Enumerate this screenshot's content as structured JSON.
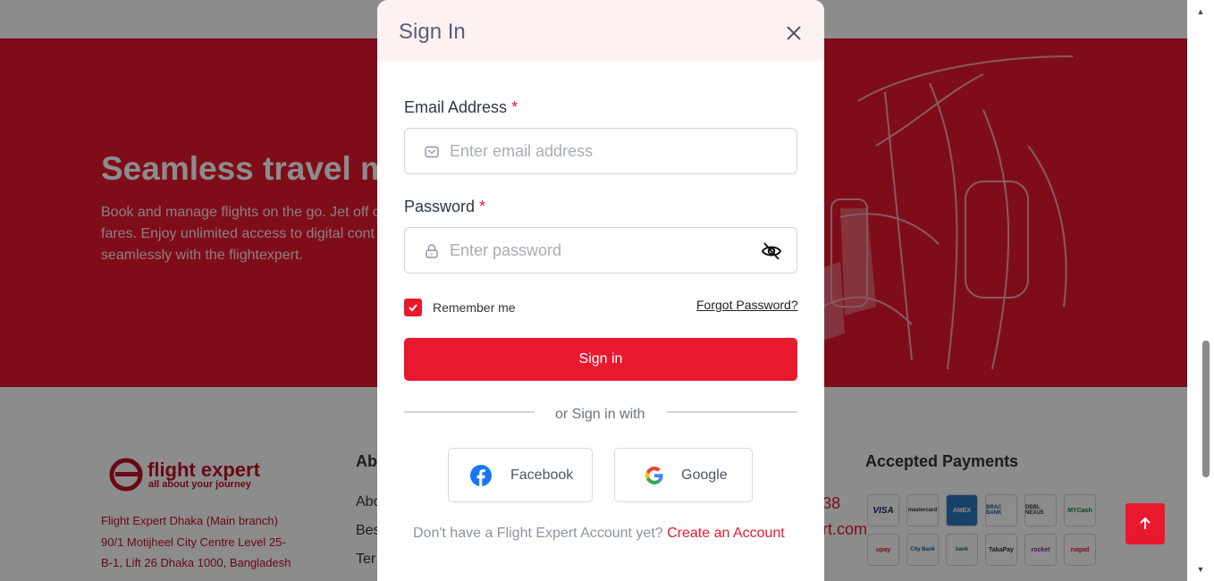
{
  "hero": {
    "title": "Seamless travel m",
    "text": "Book and manage flights on the go. Jet off o fares. Enjoy unlimited access to digital cont seamlessly with the flightexpert."
  },
  "footer": {
    "logo_name": "flight expert",
    "logo_tagline": "all about your journey",
    "address_lines": [
      "Flight Expert Dhaka (Main branch)",
      "90/1 Motijheel City Centre Level 25-",
      "B-1, Lift 26 Dhaka 1000, Bangladesh"
    ],
    "about_heading": "Ab",
    "about_links": [
      "Abo",
      "Bes",
      "Ter"
    ],
    "contact_fragments": [
      "38",
      "rt.com"
    ],
    "payments_heading": "Accepted Payments",
    "payment_methods": [
      "VISA",
      "mastercard",
      "AMEX",
      "BRAC BANK",
      "DBBL NEXUS",
      "MYCash",
      "upay",
      "City Bank",
      "bank",
      "TakaPay",
      "rocket",
      "nagad"
    ]
  },
  "modal": {
    "title": "Sign In",
    "email_label": "Email Address",
    "email_placeholder": "Enter email address",
    "password_label": "Password",
    "password_placeholder": "Enter password",
    "required_mark": "*",
    "remember_label": "Remember me",
    "remember_checked": true,
    "forgot_label": "Forgot Password?",
    "signin_label": "Sign in",
    "or_text": "or Sign in with",
    "facebook_label": "Facebook",
    "google_label": "Google",
    "no_account_text": "Don't have a Flight Expert Account yet?",
    "create_account_label": "Create an Account"
  },
  "colors": {
    "brand_red": "#e8192e",
    "dark_red": "#c0102a",
    "facebook_blue": "#1877f2"
  }
}
